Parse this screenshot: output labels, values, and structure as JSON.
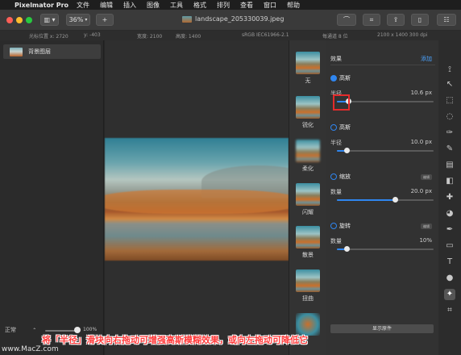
{
  "menubar": {
    "app_name": "Pixelmator Pro",
    "items": [
      "文件",
      "编辑",
      "插入",
      "图像",
      "工具",
      "格式",
      "排列",
      "查看",
      "窗口",
      "帮助"
    ]
  },
  "toolbar": {
    "zoom": "36%",
    "add_label": "+",
    "document_title": "landscape_205330039.jpeg"
  },
  "infobar": {
    "cursor_x": "光标位置 x:  2720",
    "cursor_y": "y:  -403",
    "width": "宽度: 2100",
    "height": "高度: 1400",
    "color_profile": "sRGB IEC61966-2.1",
    "bits": "每通道 8 位",
    "dimensions": "2100 x 1400 300 dpi"
  },
  "layers": {
    "items": [
      {
        "label": "背景图层"
      }
    ],
    "blend_mode": "正常",
    "opacity": "100%"
  },
  "effects_browser": {
    "items": [
      "无",
      "锐化",
      "柔化",
      "闪耀",
      "散景",
      "扭曲"
    ]
  },
  "inspector": {
    "title": "效果",
    "add_label": "添加",
    "sections": [
      {
        "name": "高斯",
        "enabled": true,
        "param_label": "半径",
        "param_value": "10.6 px",
        "level": 0.12
      },
      {
        "name": "高斯",
        "enabled": false,
        "param_label": "半径",
        "param_value": "10.0 px",
        "level": 0.1
      },
      {
        "name": "缩放",
        "enabled": false,
        "edit_label": "编辑",
        "param_label": "数量",
        "param_value": "20.0 px",
        "level": 0.6
      },
      {
        "name": "旋转",
        "enabled": false,
        "edit_label": "编辑",
        "param_label": "数量",
        "param_value": "10%",
        "level": 0.1
      }
    ],
    "show_original_label": "显示原件"
  },
  "caption": "将「半径」滑块向右拖动可增强高斯模糊效果，或向左拖动可降低它",
  "watermark": "www.MacZ.com",
  "colors": {
    "accent": "#2f86f0",
    "highlight": "#e32b2b"
  }
}
